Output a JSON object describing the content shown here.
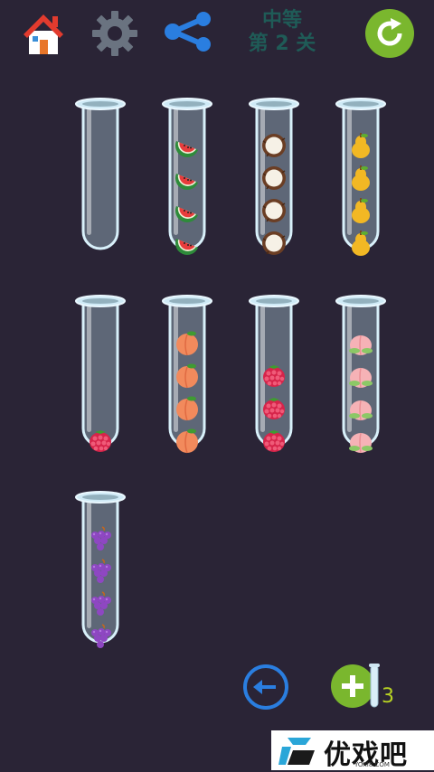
{
  "header": {
    "difficulty": "中等",
    "level": "第 2 关"
  },
  "tubes": [
    {
      "fruits": []
    },
    {
      "fruits": [
        "watermelon",
        "watermelon",
        "watermelon",
        "watermelon"
      ]
    },
    {
      "fruits": [
        "coconut",
        "coconut",
        "coconut",
        "coconut"
      ]
    },
    {
      "fruits": [
        "pear",
        "pear",
        "pear",
        "pear"
      ]
    },
    {
      "fruits": [
        "raspberry"
      ]
    },
    {
      "fruits": [
        "peach",
        "peach",
        "peach",
        "peach"
      ]
    },
    {
      "fruits": [
        "raspberry",
        "raspberry",
        "raspberry"
      ]
    },
    {
      "fruits": [
        "pink-peach",
        "pink-peach",
        "pink-peach",
        "pink-peach"
      ]
    },
    {
      "fruits": [
        "grape",
        "grape",
        "grape",
        "grape"
      ]
    }
  ],
  "footer": {
    "add_tube_count": "3"
  },
  "watermark": {
    "brand": "优戏吧",
    "url": "YOXI8.COM"
  },
  "colors": {
    "background": "#2a2436",
    "home_roof": "#e23b2e",
    "gear": "#6a7380",
    "share": "#2a7ee0",
    "restart": "#7ab72e",
    "undo": "#2a7ee0",
    "add": "#7ab72e",
    "count": "#b8d323"
  }
}
